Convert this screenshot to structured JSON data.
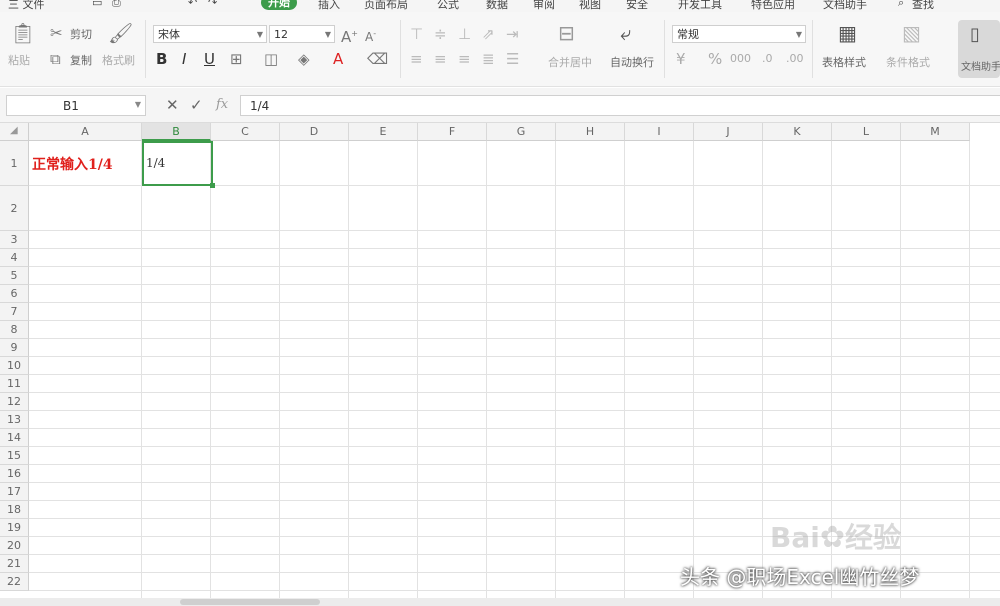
{
  "menu": {
    "file": "三 文件",
    "tabs": [
      "开始",
      "插入",
      "页面布局",
      "公式",
      "数据",
      "审阅",
      "视图",
      "安全",
      "开发工具",
      "特色应用",
      "文档助手"
    ],
    "search": "查找"
  },
  "ribbon": {
    "paste": "粘贴",
    "cut": "剪切",
    "copy": "复制",
    "format_painter": "格式刷",
    "font_name": "宋体",
    "font_size": "12",
    "merge_center": "合并居中",
    "wrap_text": "自动换行",
    "number_format": "常规",
    "conditional_format": "条件格式",
    "table_style": "表格样式",
    "doc_assistant": "文档助手"
  },
  "formula_bar": {
    "name_box": "B1",
    "fx": "fx",
    "value": "1/4"
  },
  "sheet": {
    "columns": [
      "A",
      "B",
      "C",
      "D",
      "E",
      "F",
      "G",
      "H",
      "I",
      "J",
      "K",
      "L",
      "M"
    ],
    "rows": [
      "1",
      "2",
      "3",
      "4",
      "5",
      "6",
      "7",
      "8",
      "9",
      "10",
      "11",
      "12",
      "13",
      "14",
      "15",
      "16",
      "17",
      "18",
      "19",
      "20",
      "21",
      "22"
    ],
    "cells": {
      "A1": "正常输入1/4",
      "B1": "1/4"
    },
    "colors": {
      "a1_text": "#e0201c",
      "selection": "#3d9c4b"
    }
  },
  "watermark": {
    "baidu": "Bai",
    "baidu_suffix": "经验",
    "credit": "头条 @职场Excel幽竹丝梦"
  }
}
